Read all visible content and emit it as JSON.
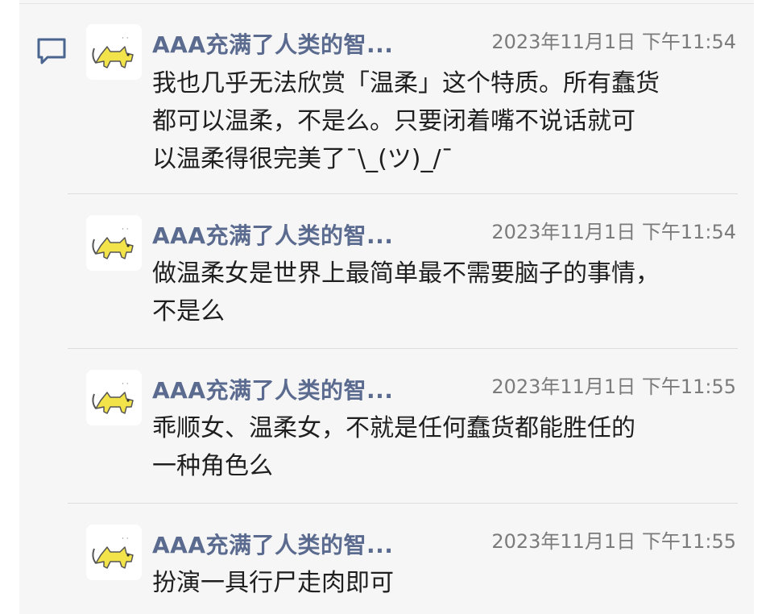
{
  "thread": {
    "messages": [
      {
        "author": "AAA充满了人类的智...",
        "time": "2023年11月1日 下午11:54",
        "lines": [
          "我也几乎无法欣赏「温柔」这个特质。所有蠢货",
          "都可以温柔，不是么。只要闭着嘴不说话就可",
          "以温柔得很完美了¯\\_(ツ)_/¯"
        ]
      },
      {
        "author": "AAA充满了人类的智...",
        "time": "2023年11月1日 下午11:54",
        "lines": [
          "做温柔女是世界上最简单最不需要脑子的事情，",
          "不是么"
        ]
      },
      {
        "author": "AAA充满了人类的智...",
        "time": "2023年11月1日 下午11:55",
        "lines": [
          "乖顺女、温柔女，不就是任何蠢货都能胜任的",
          "一种角色么"
        ]
      },
      {
        "author": "AAA充满了人类的智...",
        "time": "2023年11月1日 下午11:55",
        "lines": [
          "扮演一具行尸走肉即可"
        ]
      }
    ]
  },
  "icons": {
    "comment": "comment-icon",
    "avatar": "cat-avatar-icon"
  },
  "colors": {
    "panel_bg": "#f6f6f6",
    "author_name": "#5b6b8f",
    "timestamp": "#7b7b7b",
    "message_text": "#1f1f1f",
    "avatar_cat": "#f3e34a"
  }
}
